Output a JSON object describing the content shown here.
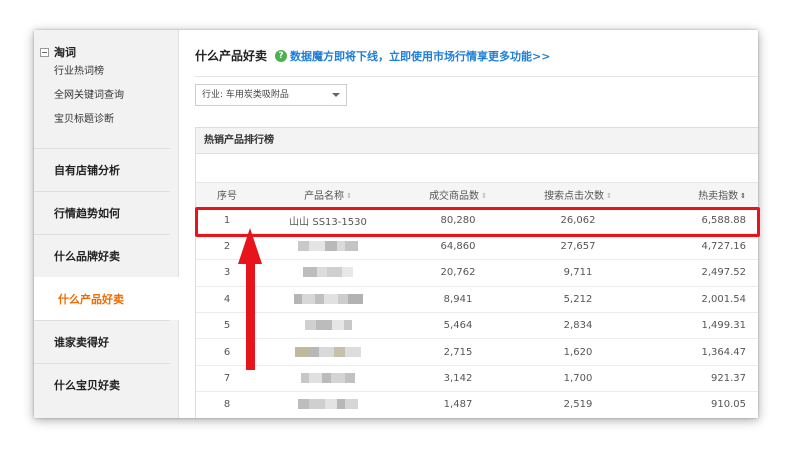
{
  "sidebar": {
    "group_title": "淘词",
    "sub_items": [
      "行业热词榜",
      "全网关键词查询",
      "宝贝标题诊断"
    ],
    "items": [
      {
        "label": "自有店铺分析",
        "active": false
      },
      {
        "label": "行情趋势如何",
        "active": false
      },
      {
        "label": "什么品牌好卖",
        "active": false
      },
      {
        "label": "什么产品好卖",
        "active": true
      },
      {
        "label": "谁家卖得好",
        "active": false
      },
      {
        "label": "什么宝贝好卖",
        "active": false
      }
    ]
  },
  "header": {
    "title": "什么产品好卖",
    "notice": "数据魔方即将下线，立即使用市场行情享更多功能>>",
    "help_icon": "question-circle-icon",
    "help_glyph": "?"
  },
  "filter": {
    "selected": "行业: 车用炭类吸附品"
  },
  "table": {
    "panel_title": "热销产品排行榜",
    "sort_glyph": "⇕",
    "active_sort_glyph": "⇕",
    "columns": [
      "序号",
      "产品名称",
      "成交商品数",
      "搜索点击次数",
      "热卖指数"
    ],
    "rows": [
      {
        "rank": "1",
        "name": "山山 SS13-1530",
        "sales": "80,280",
        "clicks": "26,062",
        "index": "6,588.88"
      },
      {
        "rank": "2",
        "name": "",
        "sales": "64,860",
        "clicks": "27,657",
        "index": "4,727.16"
      },
      {
        "rank": "3",
        "name": "",
        "sales": "20,762",
        "clicks": "9,711",
        "index": "2,497.52"
      },
      {
        "rank": "4",
        "name": "",
        "sales": "8,941",
        "clicks": "5,212",
        "index": "2,001.54"
      },
      {
        "rank": "5",
        "name": "",
        "sales": "5,464",
        "clicks": "2,834",
        "index": "1,499.31"
      },
      {
        "rank": "6",
        "name": "",
        "sales": "2,715",
        "clicks": "1,620",
        "index": "1,364.47"
      },
      {
        "rank": "7",
        "name": "",
        "sales": "3,142",
        "clicks": "1,700",
        "index": "921.37"
      },
      {
        "rank": "8",
        "name": "",
        "sales": "1,487",
        "clicks": "2,519",
        "index": "910.05"
      }
    ]
  },
  "colors": {
    "accent_orange": "#f06c00",
    "link_blue": "#1e7ed8",
    "annotation_red": "#e8141c",
    "help_green": "#4caf50"
  }
}
